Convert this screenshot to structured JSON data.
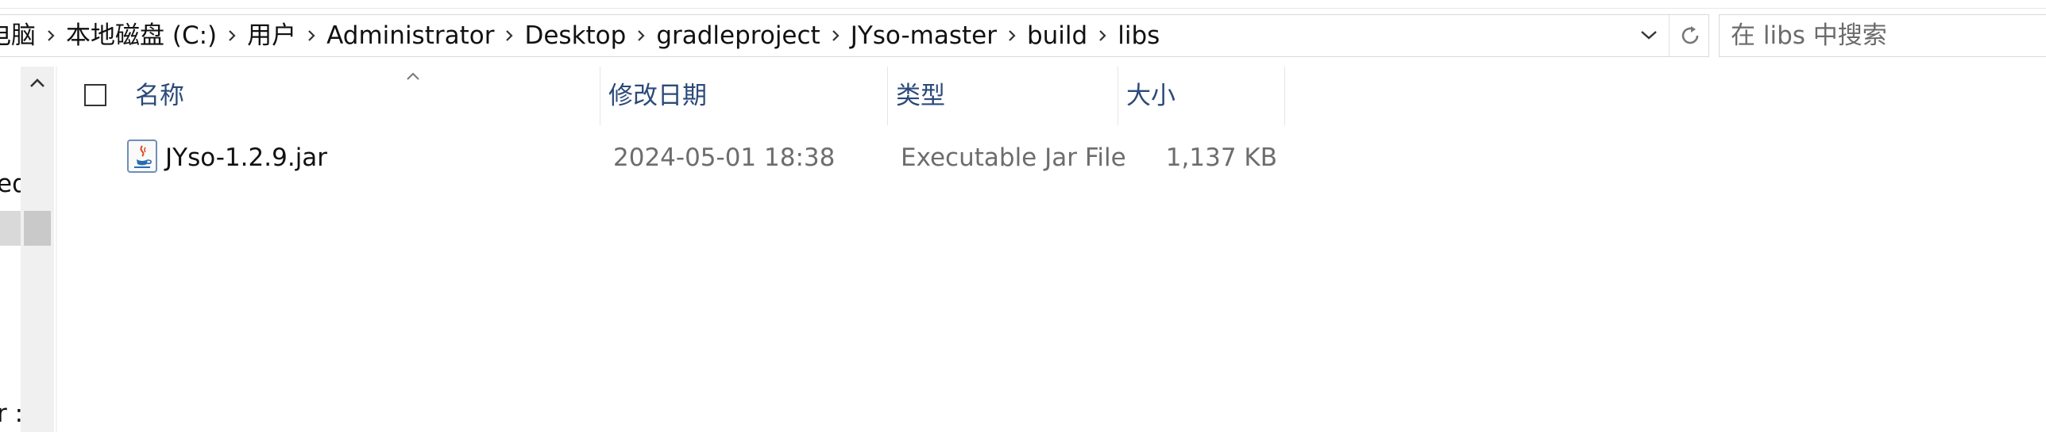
{
  "breadcrumb": {
    "items": [
      "电脑",
      "本地磁盘 (C:)",
      "用户",
      "Administrator",
      "Desktop",
      "gradleproject",
      "JYso-master",
      "build",
      "libs"
    ]
  },
  "search": {
    "placeholder": "在 libs 中搜索"
  },
  "nav": {
    "partial_items": [
      "ed",
      "r :"
    ]
  },
  "columns": {
    "name": "名称",
    "date": "修改日期",
    "type": "类型",
    "size": "大小"
  },
  "files": [
    {
      "name": "JYso-1.2.9.jar",
      "date": "2024-05-01 18:38",
      "type": "Executable Jar File",
      "size": "1,137 KB",
      "icon": "java-jar-icon"
    }
  ],
  "colors": {
    "header_text": "#2b4a7a",
    "secondary_text": "#6d6d6d",
    "border": "#d9d9d9"
  }
}
